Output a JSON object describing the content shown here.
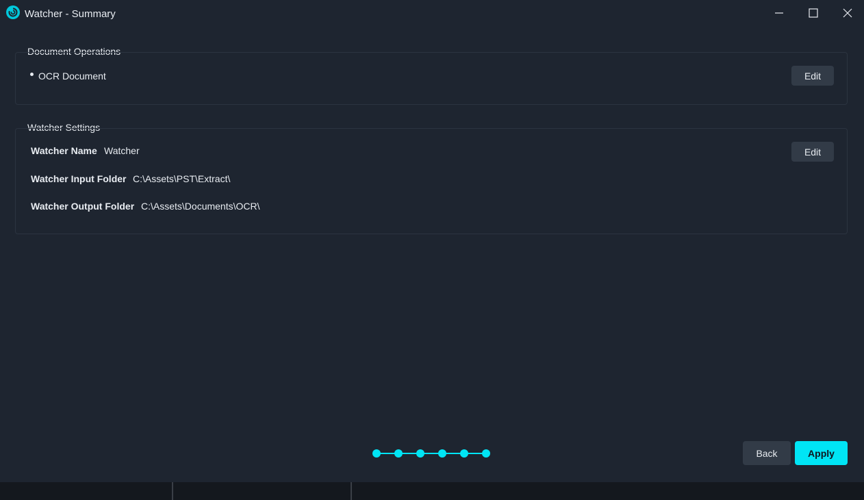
{
  "window": {
    "title": "Watcher - Summary",
    "accent_color": "#00e5f5"
  },
  "document_operations": {
    "heading": "Document Operations",
    "items": [
      "OCR Document"
    ],
    "edit_label": "Edit"
  },
  "watcher_settings": {
    "heading": "Watcher Settings",
    "edit_label": "Edit",
    "name_label": "Watcher Name",
    "name_value": "Watcher",
    "input_label": "Watcher Input Folder",
    "input_value": "C:\\Assets\\PST\\Extract\\",
    "output_label": "Watcher Output Folder",
    "output_value": "C:\\Assets\\Documents\\OCR\\"
  },
  "wizard": {
    "total_steps": 6,
    "completed_steps": 6
  },
  "footer": {
    "back_label": "Back",
    "apply_label": "Apply"
  }
}
